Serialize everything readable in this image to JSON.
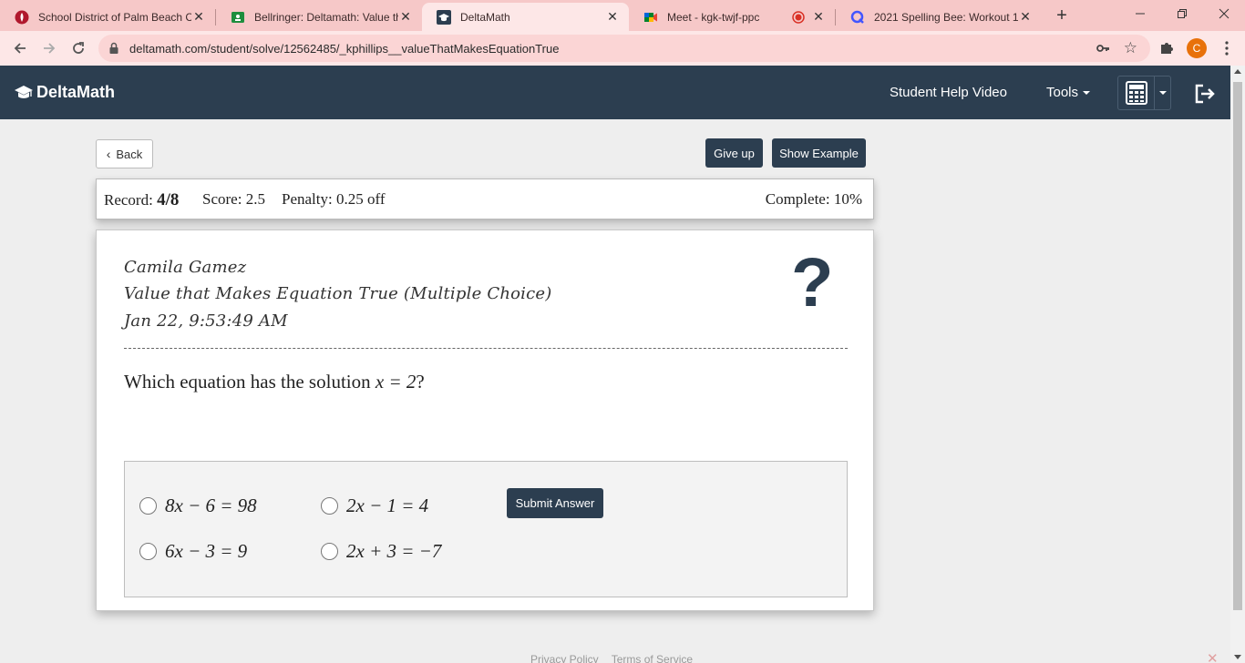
{
  "browser": {
    "tabs": [
      {
        "title": "School District of Palm Beach C",
        "icon": "palm-beach-icon",
        "active": false
      },
      {
        "title": "Bellringer: Deltamath: Value th",
        "icon": "google-classroom-icon",
        "active": false
      },
      {
        "title": "DeltaMath",
        "icon": "deltamath-icon",
        "active": true
      },
      {
        "title": "Meet - kgk-twjf-ppc",
        "icon": "google-meet-icon",
        "active": false
      },
      {
        "title": "2021 Spelling Bee: Workout 1 (",
        "icon": "quizlet-icon",
        "active": false
      }
    ],
    "new_tab": "+",
    "url": "deltamath.com/student/solve/12562485/_kphillips__valueThatMakesEquationTrue",
    "profile_initial": "C"
  },
  "nav": {
    "brand": "DeltaMath",
    "help_video": "Student Help Video",
    "tools": "Tools"
  },
  "actions": {
    "back": "Back",
    "give_up": "Give up",
    "show_example": "Show Example"
  },
  "record": {
    "record_label": "Record:",
    "record_value": "4/8",
    "score_label": "Score:",
    "score_value": "2.5",
    "penalty_label": "Penalty:",
    "penalty_value": "0.25 off",
    "complete_label": "Complete:",
    "complete_value": "10%"
  },
  "problem": {
    "student": "Camila Gamez",
    "skill": "Value that Makes Equation True (Multiple Choice)",
    "timestamp": "Jan 22, 9:53:49 AM",
    "help_mark": "?",
    "question_prefix": "Which equation has the solution ",
    "question_math": "x = 2",
    "question_suffix": "?"
  },
  "choices": [
    {
      "equation": "8x − 6 = 98"
    },
    {
      "equation": "2x − 1 = 4"
    },
    {
      "equation": "6x − 3 = 9"
    },
    {
      "equation": "2x + 3 = −7"
    }
  ],
  "submit": "Submit Answer",
  "footer": {
    "privacy": "Privacy Policy",
    "terms": "Terms of Service"
  },
  "colors": {
    "nav_bg": "#2c3e50",
    "tabbar_bg": "#f6c8c8",
    "page_bg": "#eeeeee"
  }
}
